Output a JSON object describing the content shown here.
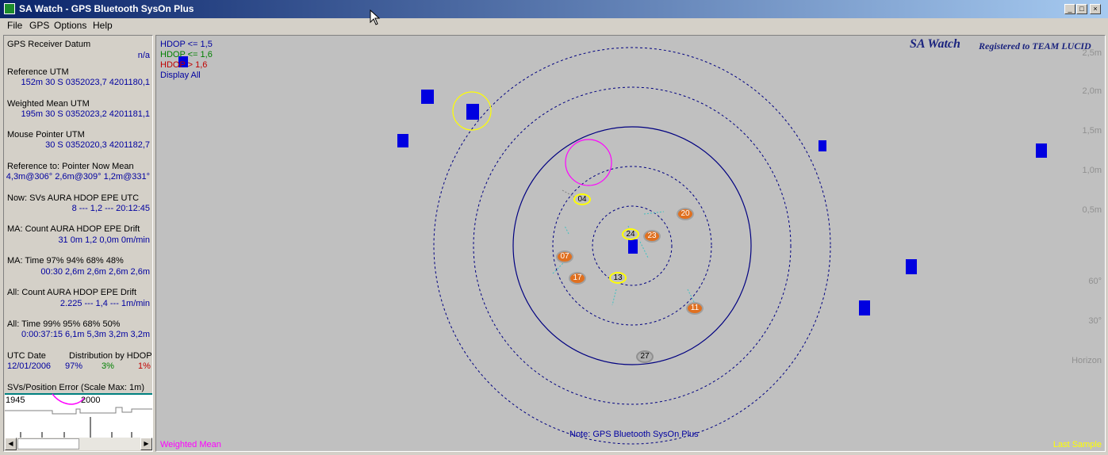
{
  "window": {
    "title": "SA Watch - GPS Bluetooth SysOn Plus"
  },
  "menu": [
    "File",
    "GPS",
    "Options",
    "Help"
  ],
  "panel": {
    "receiver_datum_label": "GPS Receiver Datum",
    "receiver_datum_value": "n/a",
    "ref_utm_label": "Reference UTM",
    "ref_utm_value": "152m 30 S 0352023,7  4201180,1",
    "wm_utm_label": "Weighted Mean UTM",
    "wm_utm_value": "195m 30 S 0352023,2  4201181,1",
    "mouse_utm_label": "Mouse Pointer UTM",
    "mouse_utm_value": "30 S 0352020,3  4201182,7",
    "refto_label": "Reference to:   Pointer  Now   Mean",
    "refto_value": "4,3m@306° 2,6m@309° 1,2m@331°",
    "now_label": "Now:  SVs  AURA  HDOP  EPE  UTC",
    "now_value": "8    ---    1,2    ---    20:12:45",
    "ma_label": "MA:  Count  AURA  HDOP  EPE  Drift",
    "ma_value": "31   0m  1,2  0,0m  0m/min",
    "matime_label": "MA:   Time      97%   94%   68%   48%",
    "matime_value": "00:30  2,6m  2,6m  2,6m  2,6m",
    "all_label": "All:   Count  AURA  HDOP  EPE  Drift",
    "all_value": "2.225   ---   1,4   ---   1m/min",
    "alltime_label": "All:    Time      99%   95%   68%   50%",
    "alltime_value": "0:00:37:15  6,1m  5,3m  3,2m  3,2m",
    "utc_date_label": "UTC Date",
    "dist_label": "Distribution by HDOP",
    "utc_date_value": "12/01/2006",
    "dist_blue": "97%",
    "dist_green": "3%",
    "dist_red": "1%",
    "svpos_label": "SVs/Position Error (Scale Max: 1m)",
    "graph_left": "1945",
    "graph_right": "2000"
  },
  "plot": {
    "legend_blue": "HDOP <= 1,5",
    "legend_green": "HDOP <= 1,6",
    "legend_red": "HDOP >  1,6",
    "legend_all": "Display All",
    "brand": "SA Watch",
    "registered": "Registered to TEAM LUCID",
    "scale_labels": [
      "2,5m",
      "2,0m",
      "1,5m",
      "1,0m",
      "0,5m"
    ],
    "elev_labels": [
      "60°",
      "30°",
      "Horizon"
    ],
    "note": "Note: GPS Bluetooth SysOn Plus",
    "bottom_left": "Weighted Mean",
    "bottom_right": "Last Sample",
    "satellites": [
      {
        "id": "04",
        "kind": "yellow"
      },
      {
        "id": "20",
        "kind": "orange"
      },
      {
        "id": "24",
        "kind": "yellow"
      },
      {
        "id": "23",
        "kind": "orange"
      },
      {
        "id": "07",
        "kind": "orange"
      },
      {
        "id": "17",
        "kind": "orange"
      },
      {
        "id": "13",
        "kind": "yellow"
      },
      {
        "id": "11",
        "kind": "orange"
      },
      {
        "id": "27",
        "kind": "gray"
      }
    ]
  },
  "colors": {
    "blue_text": "#0000a0",
    "green_text": "#008000",
    "red_text": "#c00000",
    "magenta": "#ff00ff",
    "yellow": "#ffff00",
    "orange": "#e07020",
    "ring": "#000080",
    "cyan": "#40c0c0"
  }
}
